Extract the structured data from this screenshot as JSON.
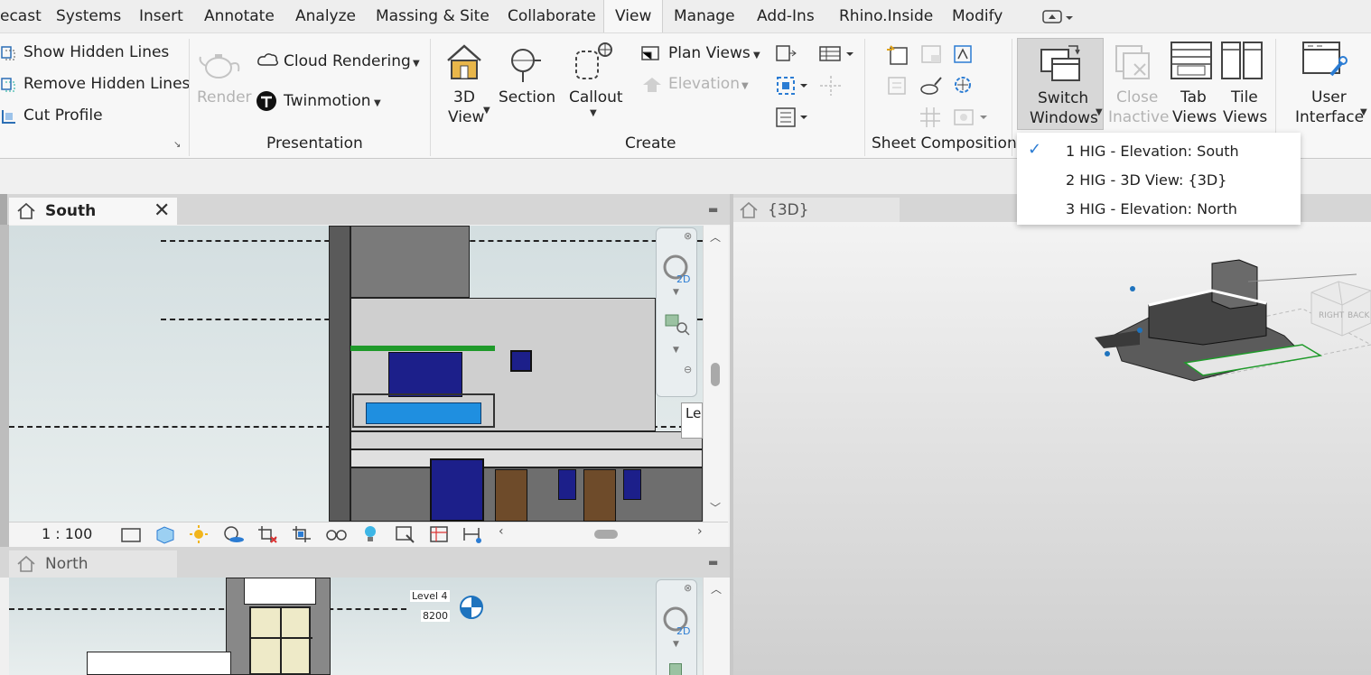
{
  "tabs": [
    {
      "label": "ecast"
    },
    {
      "label": "Systems"
    },
    {
      "label": "Insert"
    },
    {
      "label": "Annotate"
    },
    {
      "label": "Analyze"
    },
    {
      "label": "Massing & Site"
    },
    {
      "label": "Collaborate"
    },
    {
      "label": "View"
    },
    {
      "label": "Manage"
    },
    {
      "label": "Add-Ins"
    },
    {
      "label": "Rhino.Inside"
    },
    {
      "label": "Modify"
    }
  ],
  "active_tab": "View",
  "graphics": {
    "show_hidden_lines": "Show  Hidden Lines",
    "remove_hidden_lines": "Remove  Hidden Lines",
    "cut_profile": "Cut  Profile"
  },
  "presentation": {
    "title": "Presentation",
    "render": "Render",
    "cloud_rendering": "Cloud  Rendering",
    "twinmotion": "Twinmotion"
  },
  "create": {
    "title": "Create",
    "view_3d_line1": "3D",
    "view_3d_line2": "View",
    "section": "Section",
    "callout": "Callout",
    "plan_views": "Plan  Views",
    "elevation": "Elevation"
  },
  "sheet_composition": {
    "title": "Sheet Composition"
  },
  "windows": {
    "switch_line1": "Switch",
    "switch_line2": "Windows",
    "close_line1": "Close",
    "close_line2": "Inactive",
    "tab_line1": "Tab",
    "tab_line2": "Views",
    "tile_line1": "Tile",
    "tile_line2": "Views"
  },
  "user_interface": {
    "line1": "User",
    "line2": "Interface"
  },
  "switch_windows_menu": [
    {
      "label": "1 HIG - Elevation: South",
      "checked": true
    },
    {
      "label": "2 HIG - 3D View: {3D}",
      "checked": false
    },
    {
      "label": "3 HIG - Elevation: North",
      "checked": false
    }
  ],
  "views": {
    "south_tab": "South",
    "threed_tab": "{3D}",
    "north_tab": "North",
    "scale": "1 : 100",
    "level_label_partial": "Le",
    "north_level_name": "Level 4",
    "north_level_value": "8200"
  },
  "colors": {
    "accent": "#1e73be",
    "check": "#2b7cd3",
    "window_blue": "#1c1f8a",
    "glass_blue": "#1f8fe0",
    "door_brown": "#6e4b2a",
    "green_edge": "#1f9a2a"
  }
}
